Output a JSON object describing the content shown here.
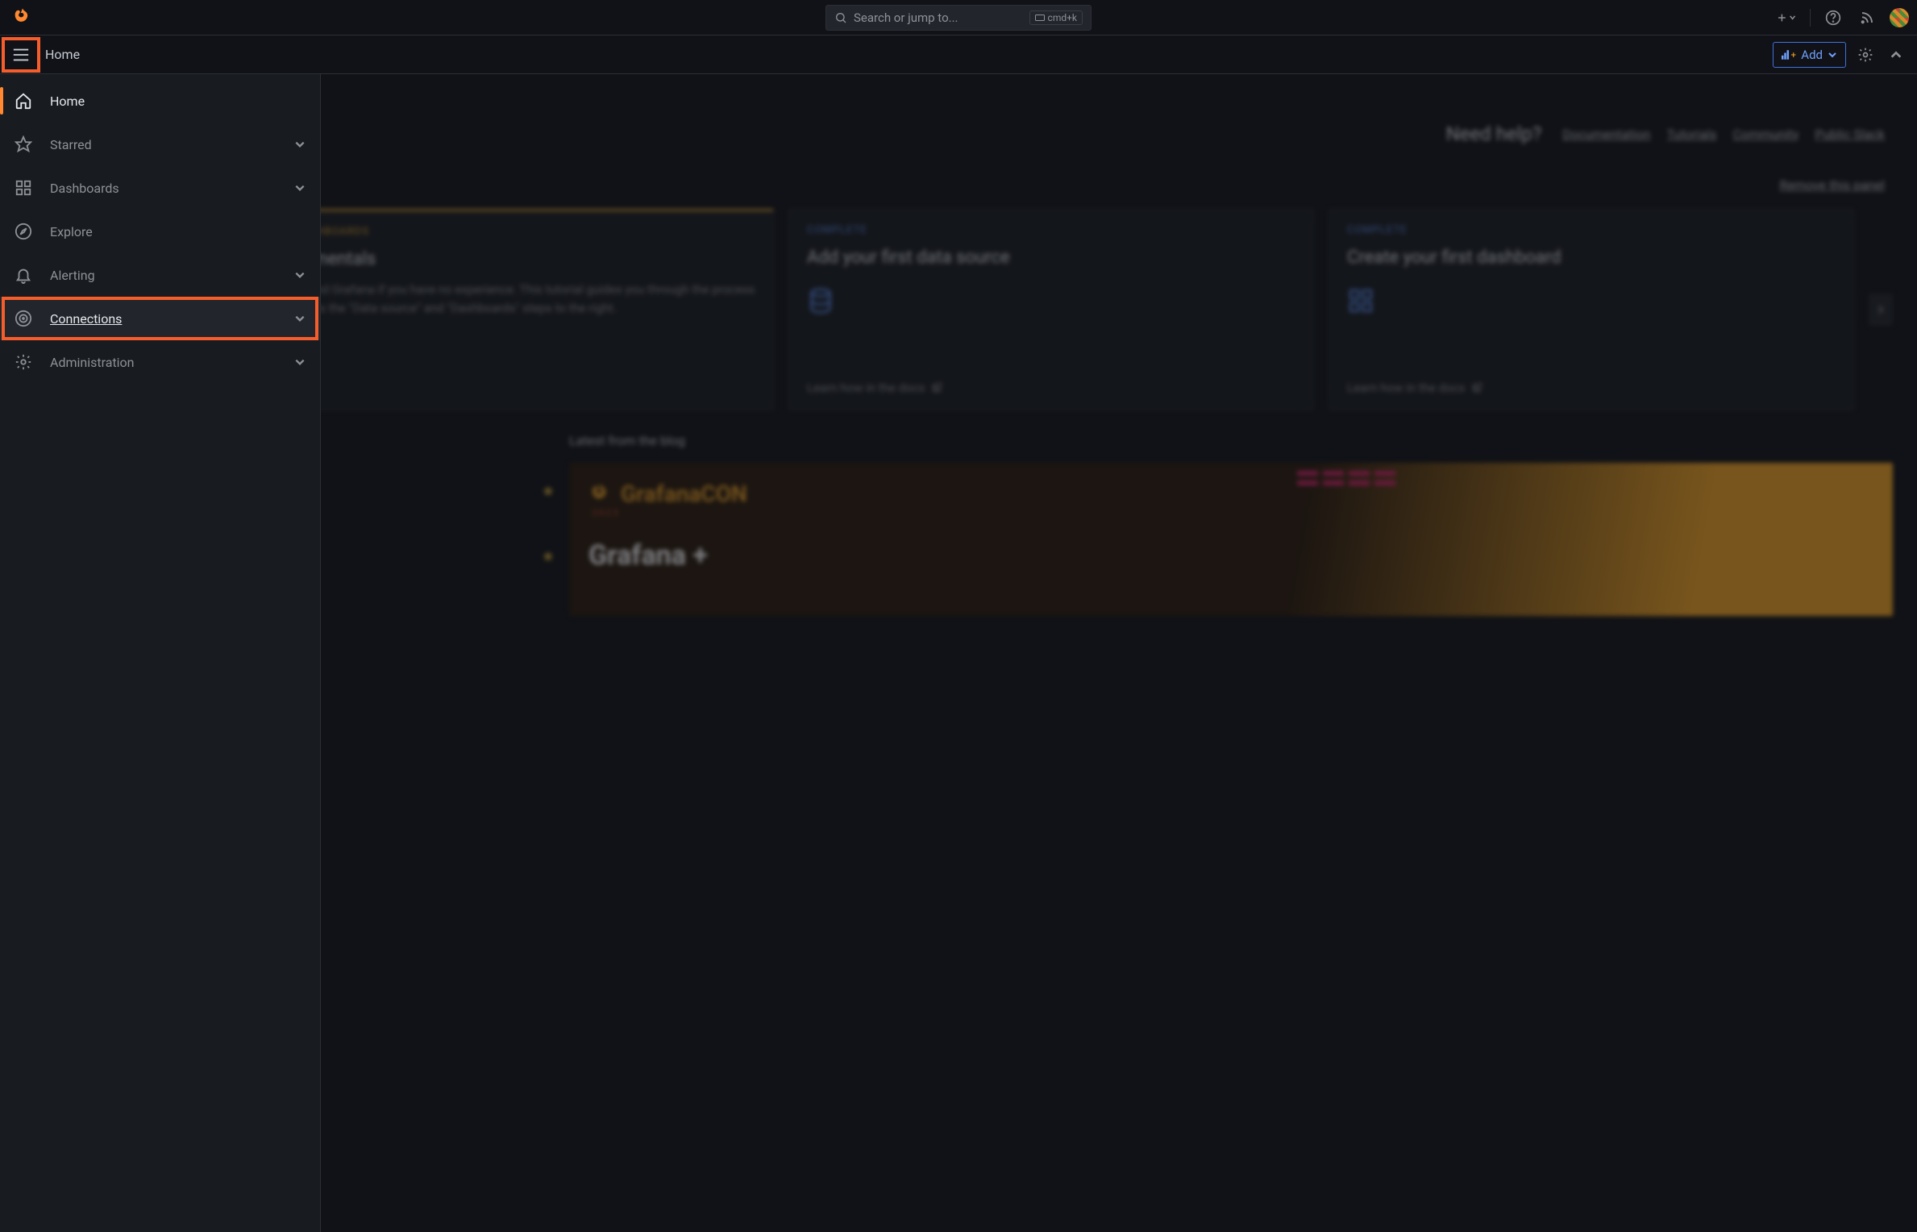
{
  "topbar": {
    "search_placeholder": "Search or jump to...",
    "kbd_hint": "cmd+k"
  },
  "breadcrumb": {
    "title": "Home",
    "add_label": "Add"
  },
  "sidebar": {
    "items": [
      {
        "label": "Home"
      },
      {
        "label": "Starred"
      },
      {
        "label": "Dashboards"
      },
      {
        "label": "Explore"
      },
      {
        "label": "Alerting"
      },
      {
        "label": "Connections"
      },
      {
        "label": "Administration"
      }
    ]
  },
  "main": {
    "help_question": "Need help?",
    "help_links": [
      "Documentation",
      "Tutorials",
      "Community",
      "Public Slack"
    ],
    "remove_panel": "Remove this panel",
    "cards": [
      {
        "eyebrow": "AND DASHBOARDS",
        "title": "fundamentals",
        "body": "Understand Grafana if you have no experience. This tutorial guides you through the process and covers the \"Data source\" and \"Dashboards\" steps to the right."
      },
      {
        "eyebrow": "COMPLETE",
        "title": "Add your first data source",
        "footer": "Learn how in the docs"
      },
      {
        "eyebrow": "COMPLETE",
        "title": "Create your first dashboard",
        "footer": "Learn how in the docs"
      }
    ],
    "blog_section_title": "Latest from the blog",
    "blog_banner_brand": "GrafanaCON",
    "blog_banner_year": "2023",
    "blog_banner_headline": "Grafana +"
  }
}
